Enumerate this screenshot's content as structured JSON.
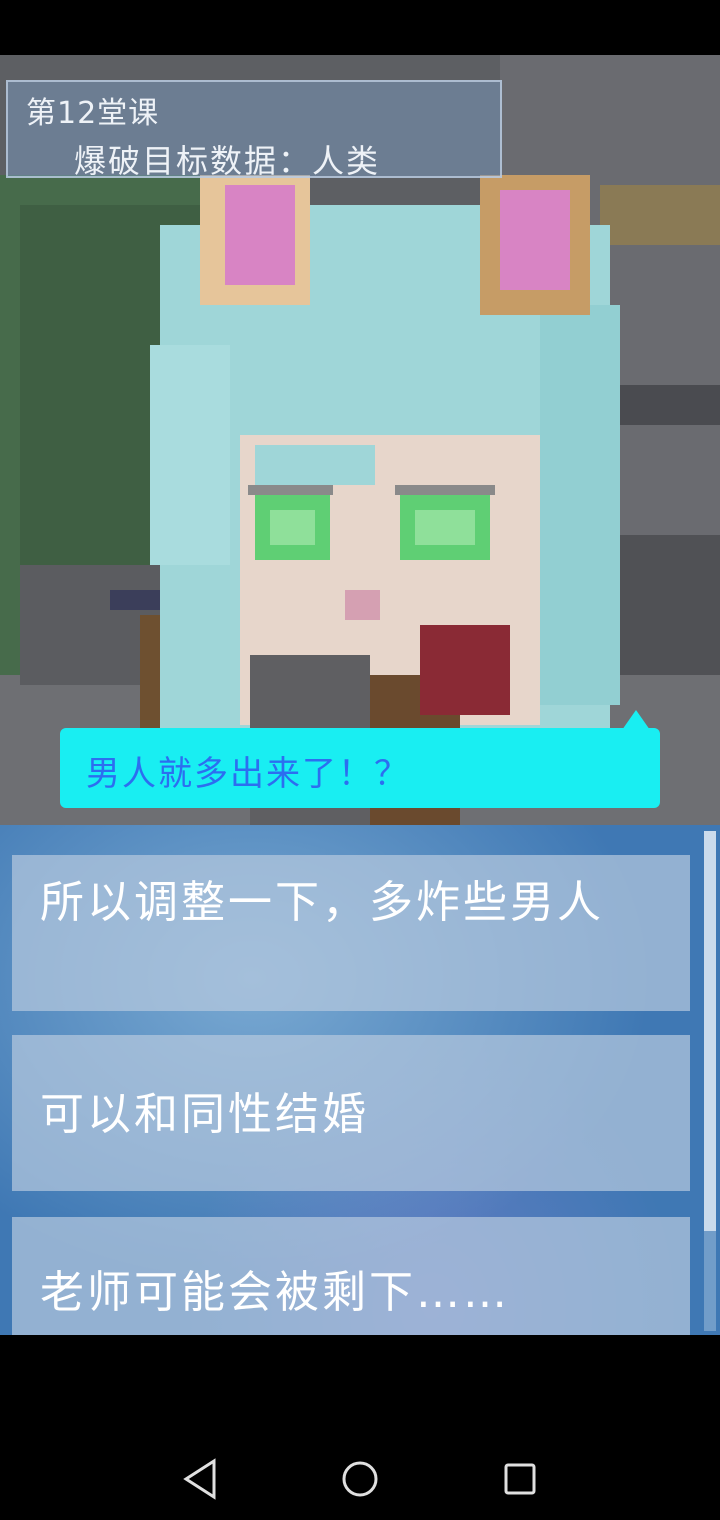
{
  "lesson": {
    "title": "第12堂课",
    "subtitle": "爆破目标数据：人类"
  },
  "dialogue": {
    "text": "男人就多出来了！？"
  },
  "choices": [
    {
      "label": "所以调整一下，多炸些男人"
    },
    {
      "label": "可以和同性结婚"
    },
    {
      "label": "老师可能会被剩下……"
    }
  ],
  "navigation": {
    "back_icon": "back-triangle-icon",
    "home_icon": "home-circle-icon",
    "recent_icon": "recent-apps-square-icon"
  },
  "colors": {
    "bubble": "#19eef2",
    "bubble_text": "#2c6ef0",
    "panel": "#3f78b4"
  }
}
